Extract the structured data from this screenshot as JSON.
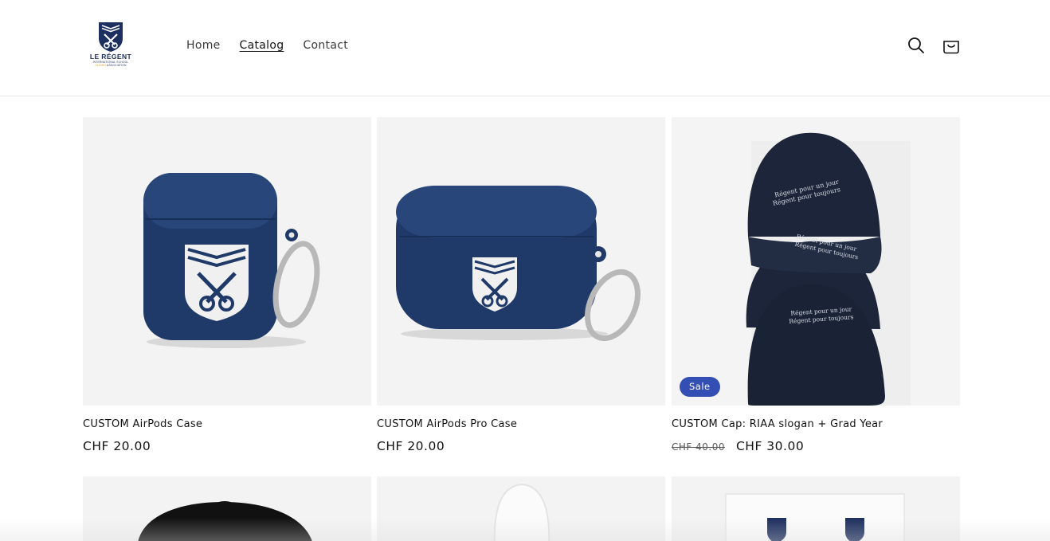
{
  "brand": {
    "logo_main": "LE RÉGENT",
    "logo_sub": "INTERNATIONAL SCHOOL",
    "logo_sub_orange": "ALUMNI",
    "logo_sub_navy": "ASSOCIATION",
    "navy": "#1d2f5e",
    "accent": "#e8a33a"
  },
  "nav": {
    "items": [
      {
        "label": "Home"
      },
      {
        "label": "Catalog"
      },
      {
        "label": "Contact"
      }
    ],
    "active": "Catalog"
  },
  "header_icons": [
    "search-icon",
    "cart-icon"
  ],
  "products": [
    {
      "title": "CUSTOM AirPods Case",
      "price": "CHF 20.00"
    },
    {
      "title": "CUSTOM AirPods Pro Case",
      "price": "CHF 20.00"
    },
    {
      "title": "CUSTOM Cap: RIAA slogan + Grad Year",
      "price_old": "CHF 40.00",
      "price": "CHF 30.00",
      "badge": "Sale"
    }
  ],
  "cap_print": {
    "line1": "Régent pour un jour",
    "line2": "Régent pour toujours"
  },
  "colors": {
    "sale_badge": "#334fb4",
    "case_navy": "#1f3a68",
    "cap_navy": "#1c2539"
  }
}
